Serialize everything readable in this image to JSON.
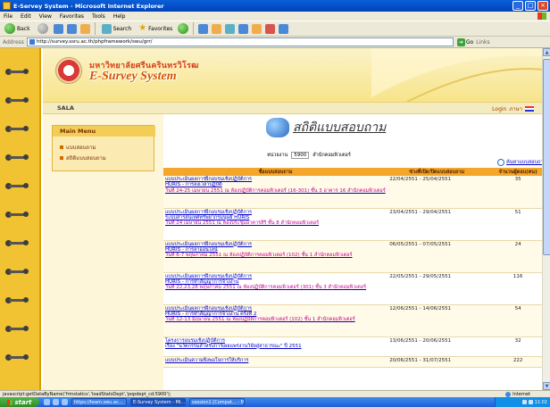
{
  "window": {
    "title": "E-Servey System - Microsoft Internet Explorer",
    "buttons": [
      "_",
      "□",
      "×"
    ]
  },
  "menu": [
    "File",
    "Edit",
    "View",
    "Favorites",
    "Tools",
    "Help"
  ],
  "toolbar": {
    "back": "Back",
    "search": "Search",
    "favorites": "Favorites"
  },
  "address": {
    "label": "Address",
    "url": "http://survey.ssru.ac.th/phpframework/swu/grr/",
    "go": "Go",
    "links": "Links"
  },
  "site": {
    "university": "มหาวิทยาลัยศรีนครินทรวิโรฒ",
    "system": "E-Survey System",
    "brand": "SALA",
    "login": "Login",
    "lang": "ภาษา"
  },
  "leftmenu": {
    "title": "Main Menu",
    "items": [
      "แบบสอบถาม",
      "สถิติแบบสอบถาม"
    ]
  },
  "main": {
    "title": "สถิติแบบสอบถาม",
    "dept_label": "หน่วยงาน",
    "dept_code": "5900",
    "dept_name": "สำนักคอมพิวเตอร์",
    "search_link": "ค้นหาแบบสอบถาม",
    "columns": [
      "ชื่อแบบสอบถาม",
      "ช่วงที่เปิด/ปิดแบบสอบถาม",
      "จำนวนผู้ตอบ(คน)"
    ],
    "rows": [
      {
        "name": "แบบประเมินผลการฝึกอบรมเชิงปฏิบัติการ",
        "line2": "HURIS - การลงเวลาปฏิบัติ",
        "detail": "วันที่ 24-25 เมษายน 2551 ณ ห้องปฏิบัติการคอมพิวเตอร์ (16-301) ชั้น 3 อาคาร 16 สำนักคอมพิวเตอร์",
        "period": "22/04/2551 - 25/04/2551",
        "count": "35"
      },
      {
        "name": "แบบประเมินผลการฝึกอบรมเชิงปฏิบัติการ",
        "line2": "ระบบสารสนเทศทรัพยากรมนุษย์ HURIS",
        "detail": "วันที่ 24 เมษายน 2551 ณ ห้องประชุมอาคารสิริ ชั้น 8 สำนักคอมพิวเตอร์",
        "period": "23/04/2551 - 29/04/2551",
        "count": "51"
      },
      {
        "name": "แบบประเมินผลการฝึกอบรมเชิงปฏิบัติการ",
        "line2": "HURIS - การลาออนไลน์",
        "detail": "วันที่ 6-7 พฤษภาคม 2551 ณ ห้องปฏิบัติการคอมพิวเตอร์ (102) ชั้น 1 สำนักคอมพิวเตอร์",
        "period": "06/05/2551 - 07/05/2551",
        "count": "24"
      },
      {
        "name": "แบบประเมินผลการฝึกอบรมเชิงปฏิบัติการ",
        "line2": "HURIS - การทำสัญญาการจ้างงาน",
        "detail": "วันที่ 22,23,28 พฤษภาคม 2551 ณ ห้องปฏิบัติการคอมพิวเตอร์ (301) ชั้น 3 สำนักคอมพิวเตอร์",
        "period": "22/05/2551 - 29/05/2551",
        "count": "116"
      },
      {
        "name": "แบบประเมินผลการฝึกอบรมเชิงปฏิบัติการ",
        "line2": "HURIS - การทำสัญญาการจ้างงาน ครั้งที่ 2",
        "detail": "วันที่ 12-13 มิถุนายน 2551 ณ ห้องปฏิบัติการคอมพิวเตอร์ (102) ชั้น 1 สำนักคอมพิวเตอร์",
        "period": "12/06/2551 - 14/06/2551",
        "count": "54"
      },
      {
        "name": "โครงการอบรมเชิงปฏิบัติการ",
        "line2": "เรื่อง \"นวัตกรรมสำหรับการเผยแพร่งานวิจัยสู่สาธารณะ\" ปี 2551",
        "detail": "",
        "period": "13/06/2551 - 20/06/2551",
        "count": "32"
      },
      {
        "name": "แบบประเมินความพึงพอใจการให้บริการ",
        "line2": "",
        "detail": "",
        "period": "20/06/2551 - 31/07/2551",
        "count": "222"
      }
    ]
  },
  "status": {
    "text": "javascript:getDataByName('frmstatics','loadStatsDept','popdept_cd:5900');",
    "zone": "Internet"
  },
  "taskbar": {
    "start": "start",
    "tasks": [
      "https://team.swu.ac...",
      "E-Survey System - Mi...",
      "session1 [Compat... - M..."
    ],
    "clock": "11:02"
  }
}
